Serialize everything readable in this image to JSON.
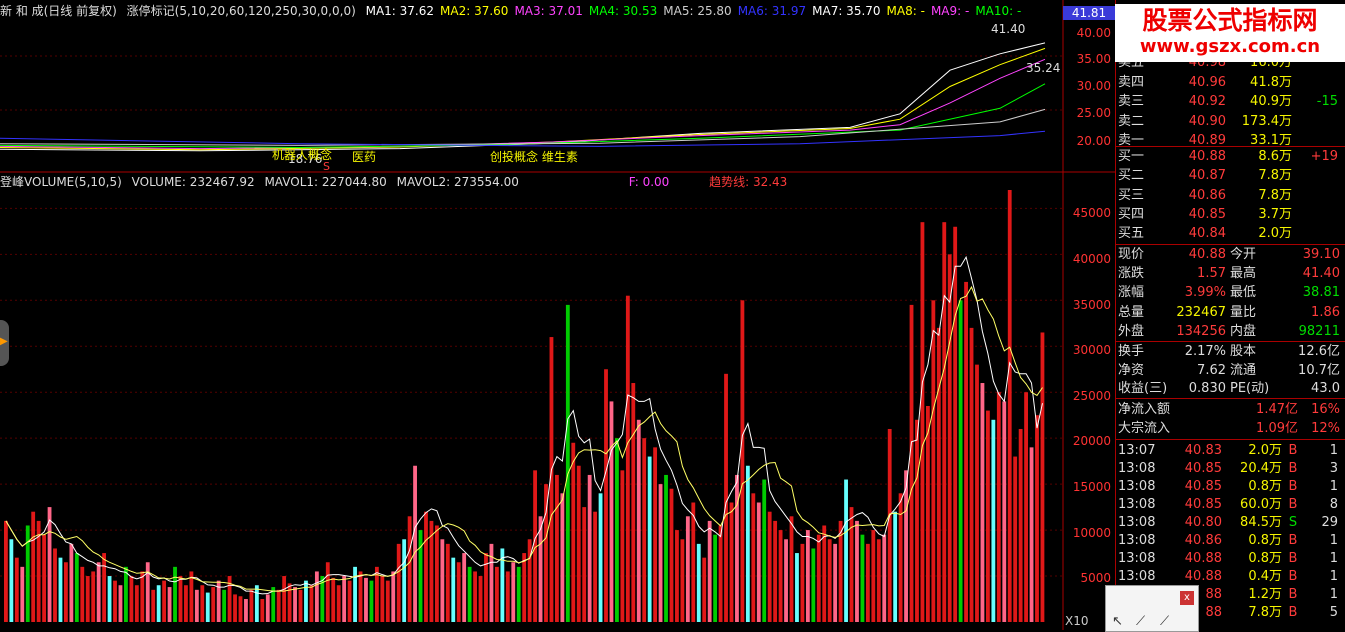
{
  "price_header": {
    "title": "新 和 成(日线 前复权)",
    "indicator": "涨停标记(5,10,20,60,120,250,30,0,0,0)",
    "mas": [
      {
        "label": "MA1: 37.62",
        "color": "#ffffff"
      },
      {
        "label": "MA2: 37.60",
        "color": "#ffff00"
      },
      {
        "label": "MA3: 37.01",
        "color": "#ff44ff"
      },
      {
        "label": "MA4: 30.53",
        "color": "#00ff00"
      },
      {
        "label": "MA5: 25.80",
        "color": "#cccccc"
      },
      {
        "label": "MA6: 31.97",
        "color": "#3333ff"
      },
      {
        "label": "MA7: 35.70",
        "color": "#ffffff"
      },
      {
        "label": "MA8: -",
        "color": "#ffff00"
      },
      {
        "label": "MA9: -",
        "color": "#ff44ff"
      },
      {
        "label": "MA10: -",
        "color": "#00ff00"
      }
    ]
  },
  "price_axis": {
    "current_tag": "41.81",
    "ticks": [
      "40.00",
      "35.00",
      "30.00",
      "25.00",
      "20.00"
    ]
  },
  "price_annotations": {
    "high": "41.40",
    "low_right": "35.24",
    "low_left": "18.76",
    "concept1": "机器人概念",
    "concept2": "医药",
    "concept3": "创投概念 维生素",
    "marker": "S"
  },
  "vol_header": {
    "label": "登峰VOLUME(5,10,5)",
    "volume": "VOLUME: 232467.92",
    "mavol1": "MAVOL1: 227044.80",
    "mavol2": "MAVOL2: 273554.00",
    "f": "F: 0.00",
    "trend": "趋势线: 32.43"
  },
  "vol_axis": {
    "ticks": [
      "45000",
      "40000",
      "35000",
      "30000",
      "25000",
      "20000",
      "15000",
      "10000",
      "5000"
    ],
    "unit": "X10"
  },
  "watermark": {
    "line1": "股票公式指标网",
    "line2": "www.gszx.com.cn"
  },
  "order_book": {
    "asks": [
      {
        "label": "卖五",
        "price": "40.98",
        "vol": "16.0万"
      },
      {
        "label": "卖四",
        "price": "40.96",
        "vol": "41.8万"
      },
      {
        "label": "卖三",
        "price": "40.92",
        "vol": "40.9万",
        "chg": "-15"
      },
      {
        "label": "卖二",
        "price": "40.90",
        "vol": "173.4万"
      },
      {
        "label": "卖一",
        "price": "40.89",
        "vol": "33.1万"
      }
    ],
    "bids": [
      {
        "label": "买一",
        "price": "40.88",
        "vol": "8.6万",
        "chg": "+19"
      },
      {
        "label": "买二",
        "price": "40.87",
        "vol": "7.8万"
      },
      {
        "label": "买三",
        "price": "40.86",
        "vol": "7.8万"
      },
      {
        "label": "买四",
        "price": "40.85",
        "vol": "3.7万"
      },
      {
        "label": "买五",
        "price": "40.84",
        "vol": "2.0万"
      }
    ]
  },
  "quote": [
    {
      "l1": "现价",
      "v1": "40.88",
      "c1": "red",
      "l2": "今开",
      "v2": "39.10",
      "c2": "red"
    },
    {
      "l1": "涨跌",
      "v1": "1.57",
      "c1": "red",
      "l2": "最高",
      "v2": "41.40",
      "c2": "red"
    },
    {
      "l1": "涨幅",
      "v1": "3.99%",
      "c1": "red",
      "l2": "最低",
      "v2": "38.81",
      "c2": "grn"
    },
    {
      "l1": "总量",
      "v1": "232467",
      "c1": "yel",
      "l2": "量比",
      "v2": "1.86",
      "c2": "red"
    },
    {
      "l1": "外盘",
      "v1": "134256",
      "c1": "red",
      "l2": "内盘",
      "v2": "98211",
      "c2": "grn"
    }
  ],
  "stats": [
    {
      "l1": "换手",
      "v1": "2.17%",
      "l2": "股本",
      "v2": "12.6亿"
    },
    {
      "l1": "净资",
      "v1": "7.62",
      "l2": "流通",
      "v2": "10.7亿"
    },
    {
      "l1": "收益(三)",
      "v1": "0.830",
      "l2": "PE(动)",
      "v2": "43.0"
    }
  ],
  "flows": [
    {
      "label": "净流入额",
      "value": "1.47亿",
      "pct": "16%"
    },
    {
      "label": "大宗流入",
      "value": "1.09亿",
      "pct": "12%"
    }
  ],
  "ticks": [
    {
      "time": "13:07",
      "price": "40.83",
      "vol": "2.0万",
      "side": "B",
      "n": "1"
    },
    {
      "time": "13:08",
      "price": "40.85",
      "vol": "20.4万",
      "side": "B",
      "n": "3"
    },
    {
      "time": "13:08",
      "price": "40.85",
      "vol": "0.8万",
      "side": "B",
      "n": "1"
    },
    {
      "time": "13:08",
      "price": "40.85",
      "vol": "60.0万",
      "side": "B",
      "n": "8"
    },
    {
      "time": "13:08",
      "price": "40.80",
      "vol": "84.5万",
      "side": "S",
      "n": "29"
    },
    {
      "time": "13:08",
      "price": "40.86",
      "vol": "0.8万",
      "side": "B",
      "n": "1"
    },
    {
      "time": "13:08",
      "price": "40.88",
      "vol": "0.8万",
      "side": "B",
      "n": "1"
    },
    {
      "time": "13:08",
      "price": "40.88",
      "vol": "0.4万",
      "side": "B",
      "n": "1"
    },
    {
      "time": "",
      "price": "88",
      "vol": "1.2万",
      "side": "B",
      "n": "1"
    },
    {
      "time": "",
      "price": "88",
      "vol": "7.8万",
      "side": "B",
      "n": "5"
    }
  ],
  "chart_data": {
    "type": "bar",
    "volume_max": 47000,
    "series": [
      {
        "values": [
          11000,
          9000,
          7000,
          6000,
          10500,
          12000,
          11000,
          9500,
          12500,
          8000,
          7000,
          6500,
          8500,
          7500,
          6000,
          5000,
          5500,
          6500,
          7500,
          5000,
          4500,
          4000,
          6000,
          5000,
          4000,
          5500,
          6500,
          3500,
          4000,
          4500,
          3800,
          6000,
          5000,
          4000,
          5500,
          3500,
          4000,
          3200,
          3800,
          4500,
          3500,
          5000,
          3000,
          2800,
          2500,
          3500,
          4000,
          2500,
          3000,
          3800,
          3500,
          5000,
          4200,
          3800,
          3500,
          4500,
          4000,
          5500,
          5000,
          6500,
          4800,
          4000,
          5000,
          4500,
          6000,
          5500,
          4800,
          4500,
          6000,
          5000,
          4500,
          5500,
          8500,
          9000,
          11500,
          17000,
          10000,
          12000,
          11000,
          10500,
          9000,
          8500,
          7000,
          6500,
          7500,
          6000,
          5500,
          5000,
          7500,
          8500,
          6000,
          8000,
          5500,
          6500,
          6000,
          7500,
          9000,
          16500,
          11500,
          15000,
          31000,
          16000,
          14000,
          34500,
          19500,
          17000,
          12500,
          16000,
          12000,
          14000,
          27500,
          24000,
          20000,
          16500,
          35500,
          26000,
          22000,
          20000,
          18000,
          19000,
          15000,
          16000,
          14500,
          10000,
          9000,
          11500,
          13000,
          8500,
          7000,
          11000,
          9500,
          10500,
          27000,
          13000,
          16000,
          35000,
          17000,
          14000,
          13000,
          15500,
          12000,
          11000,
          10000,
          9000,
          11500,
          7500,
          8500,
          10000,
          8000,
          9500,
          10500,
          9000,
          8500,
          11000,
          15500,
          12500,
          11000,
          9500,
          8500,
          10000,
          9000,
          9500,
          21000,
          12000,
          14000,
          16500,
          34500,
          22000,
          43500,
          23500,
          35000,
          32000,
          43500,
          40000,
          43000,
          35000,
          37000,
          32000,
          28000,
          26000,
          23000,
          22000,
          25000,
          24000,
          47000,
          18000,
          21000,
          25000,
          19000,
          22500,
          31500
        ],
        "colors": "mixed"
      }
    ]
  }
}
